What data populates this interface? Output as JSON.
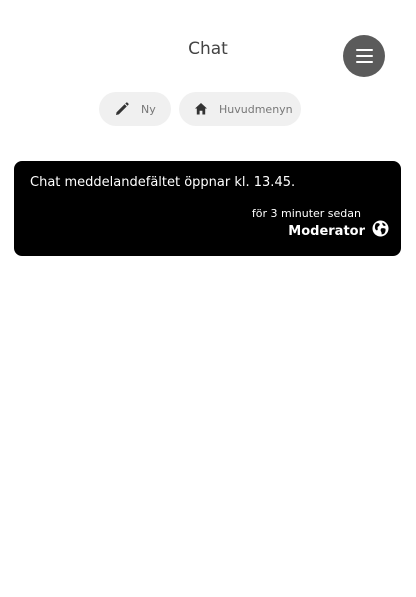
{
  "header": {
    "title": "Chat",
    "menu_icon": "hamburger-menu-icon"
  },
  "actions": [
    {
      "label": "Ny",
      "icon": "pencil-icon"
    },
    {
      "label": "Huvudmenyn",
      "icon": "home-icon"
    }
  ],
  "messages": [
    {
      "text": "Chat meddelandefältet öppnar kl. 13.45.",
      "time": "för 3 minuter sedan",
      "author": "Moderator",
      "author_icon": "globe-icon",
      "background": "#000000",
      "text_color": "#ffffff"
    }
  ],
  "colors": {
    "menu_button": "#5b5b5b",
    "pill_background": "#f0f0f0",
    "title": "#444444"
  }
}
